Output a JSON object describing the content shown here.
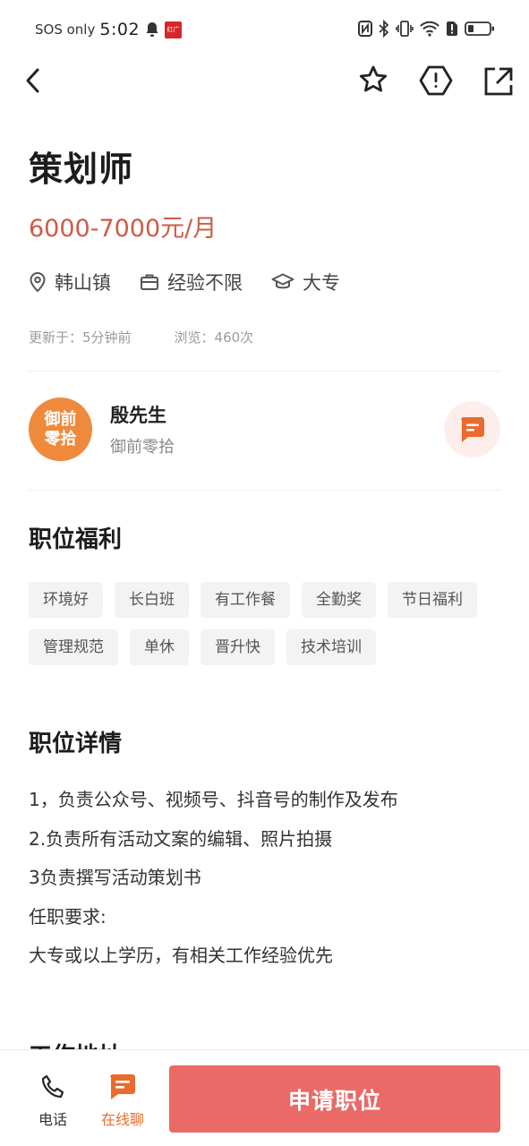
{
  "status_bar": {
    "carrier": "SOS only",
    "time": "5:02",
    "app_badge": "红广"
  },
  "job": {
    "title": "策划师",
    "salary": "6000-7000元/月",
    "location": "韩山镇",
    "experience": "经验不限",
    "education": "大专",
    "updated": "更新于：5分钟前",
    "views": "浏览：460次"
  },
  "recruiter": {
    "avatar_line1": "御前",
    "avatar_line2": "零拾",
    "name": "殷先生",
    "company": "御前零拾"
  },
  "benefits": {
    "title": "职位福利",
    "tags": [
      "环境好",
      "长白班",
      "有工作餐",
      "全勤奖",
      "节日福利",
      "管理规范",
      "单休",
      "晋升快",
      "技术培训"
    ]
  },
  "details": {
    "title": "职位详情",
    "lines": [
      "1，负责公众号、视频号、抖音号的制作及发布",
      "2.负责所有活动文案的编辑、照片拍摄",
      "3负责撰写活动策划书",
      "任职要求:",
      "大专或以上学历，有相关工作经验优先"
    ]
  },
  "next_section_peek": "工作地址",
  "bottom_bar": {
    "phone_label": "电话",
    "chat_label": "在线聊",
    "apply_label": "申请职位"
  },
  "colors": {
    "salary": "#d05a47",
    "avatar_bg": "#ef8a3c",
    "accent_orange": "#ea6b2c",
    "apply_button": "#e96a66",
    "chat_bubble_bg": "#fdeeec"
  }
}
